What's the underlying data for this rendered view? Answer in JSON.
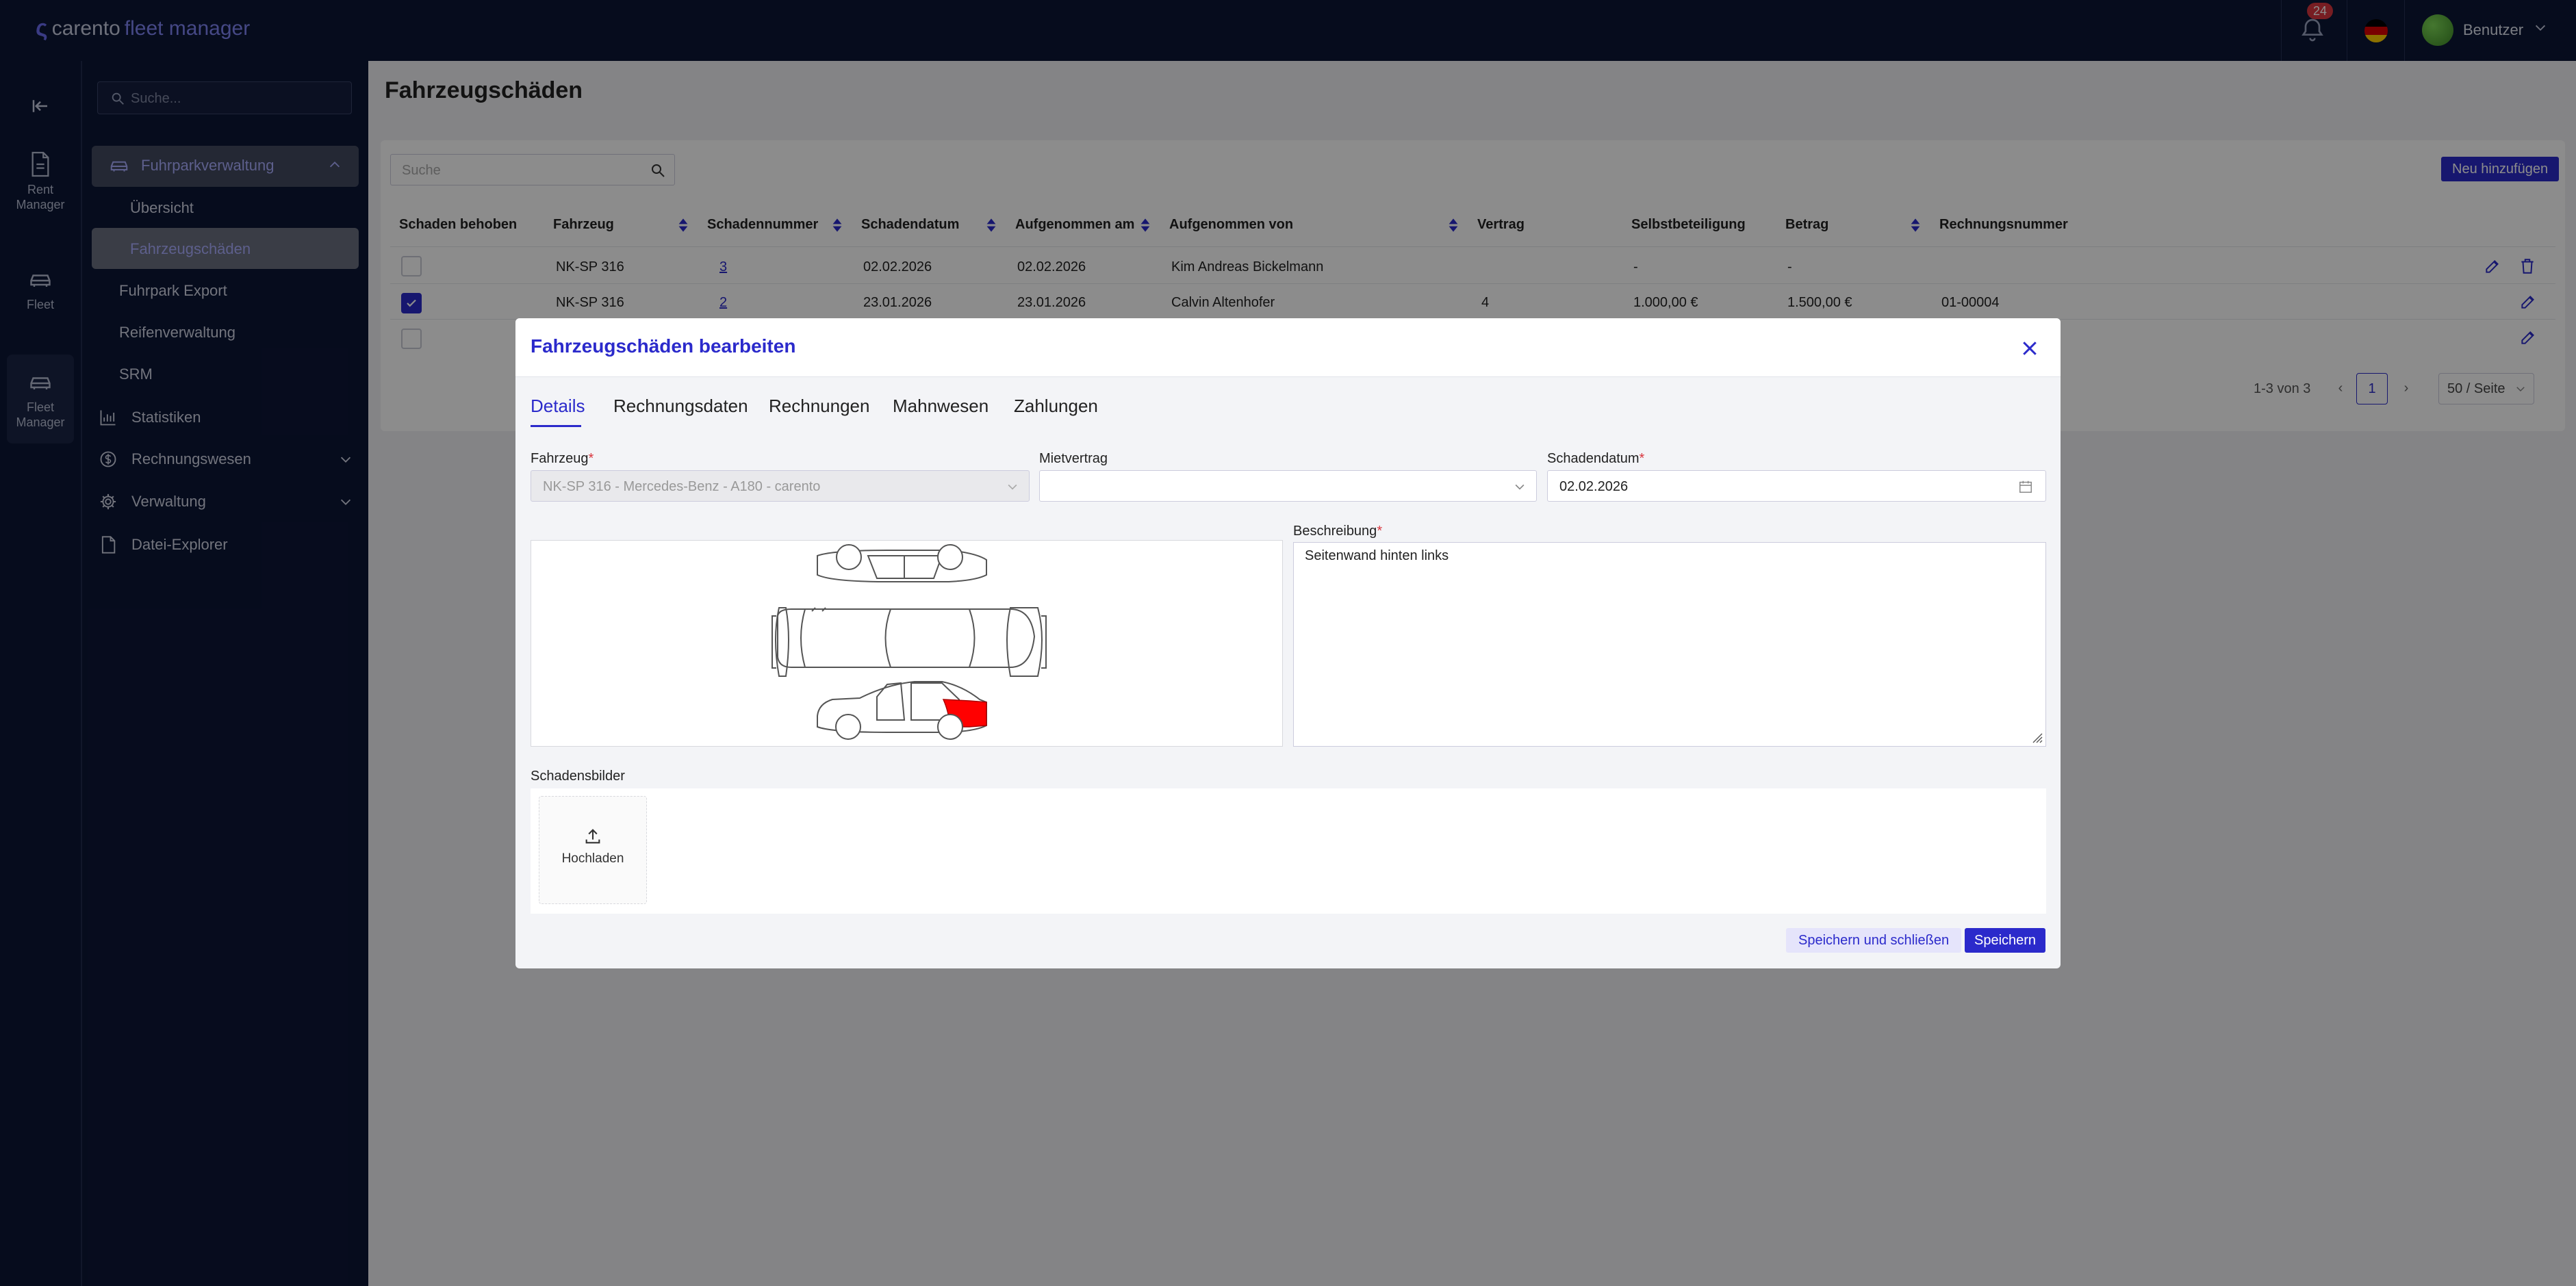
{
  "header": {
    "logo": {
      "prefix": "carento",
      "suffix": "fleet manager"
    },
    "notifications_count": "24",
    "user_name": "Benutzer"
  },
  "rail": {
    "items": [
      {
        "label": "Rent Manager",
        "icon": "document-icon"
      },
      {
        "label": "Fleet",
        "icon": "car-icon"
      },
      {
        "label": "Fleet Manager",
        "icon": "car-icon"
      }
    ]
  },
  "sidebar": {
    "search_placeholder": "Suche...",
    "group": {
      "label": "Fuhrparkverwaltung",
      "children": [
        "Übersicht",
        "Fahrzeugschäden"
      ]
    },
    "items": [
      "Fuhrpark Export",
      "Reifenverwaltung",
      "SRM"
    ],
    "icon_items": [
      "Statistiken",
      "Rechnungswesen",
      "Verwaltung",
      "Datei-Explorer"
    ]
  },
  "page": {
    "title": "Fahrzeugschäden",
    "search_placeholder": "Suche",
    "new_button": "Neu hinzufügen",
    "columns": [
      "Schaden behoben",
      "Fahrzeug",
      "Schadennummer",
      "Schadendatum",
      "Aufgenommen am",
      "Aufgenommen von",
      "Vertrag",
      "Selbstbeteiligung",
      "Betrag",
      "Rechnungsnummer"
    ],
    "rows": [
      {
        "fixed": false,
        "vehicle": "NK-SP 316",
        "number": "3",
        "date": "02.02.2026",
        "recorded_at": "02.02.2026",
        "recorded_by": "Kim Andreas Bickelmann",
        "contract": "",
        "deductible": "-",
        "amount": "-",
        "invoice": ""
      },
      {
        "fixed": true,
        "vehicle": "NK-SP 316",
        "number": "2",
        "date": "23.01.2026",
        "recorded_at": "23.01.2026",
        "recorded_by": "Calvin Altenhofer",
        "contract": "4",
        "deductible": "1.000,00 €",
        "amount": "1.500,00 €",
        "invoice": "01-00004"
      }
    ],
    "pagination": {
      "summary": "1-3 von 3",
      "current_page": "1",
      "per_page": "50 / Seite"
    }
  },
  "modal": {
    "title": "Fahrzeugschäden bearbeiten",
    "tabs": [
      "Details",
      "Rechnungsdaten",
      "Rechnungen",
      "Mahnwesen",
      "Zahlungen"
    ],
    "vehicle": {
      "label": "Fahrzeug",
      "required": "*",
      "value": "NK-SP 316 - Mercedes-Benz - A180 - carento"
    },
    "contract": {
      "label": "Mietvertrag",
      "value": ""
    },
    "damage_date": {
      "label": "Schadendatum",
      "required": "*",
      "value": "02.02.2026"
    },
    "description": {
      "label": "Beschreibung",
      "required": "*",
      "value": "Seitenwand hinten links"
    },
    "images": {
      "label": "Schadensbilder",
      "upload_label": "Hochladen"
    },
    "buttons": {
      "save_close": "Speichern und schließen",
      "save": "Speichern"
    },
    "damage_highlight_color": "#ff0000"
  }
}
